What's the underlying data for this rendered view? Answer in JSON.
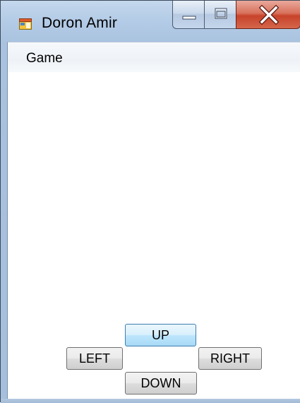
{
  "window": {
    "title": "Doron Amir",
    "app_icon": "windows-form-icon",
    "caption_buttons": [
      "minimize-icon",
      "maximize-icon",
      "close-icon"
    ]
  },
  "menu": {
    "items": [
      {
        "label": "Game"
      }
    ]
  },
  "controls": {
    "up_label": "UP",
    "left_label": "LEFT",
    "right_label": "RIGHT",
    "down_label": "DOWN"
  },
  "colors": {
    "close_button": "#c7432a",
    "focused_button_border": "#3c7fb1",
    "title_bar": "#b3cbe6"
  }
}
